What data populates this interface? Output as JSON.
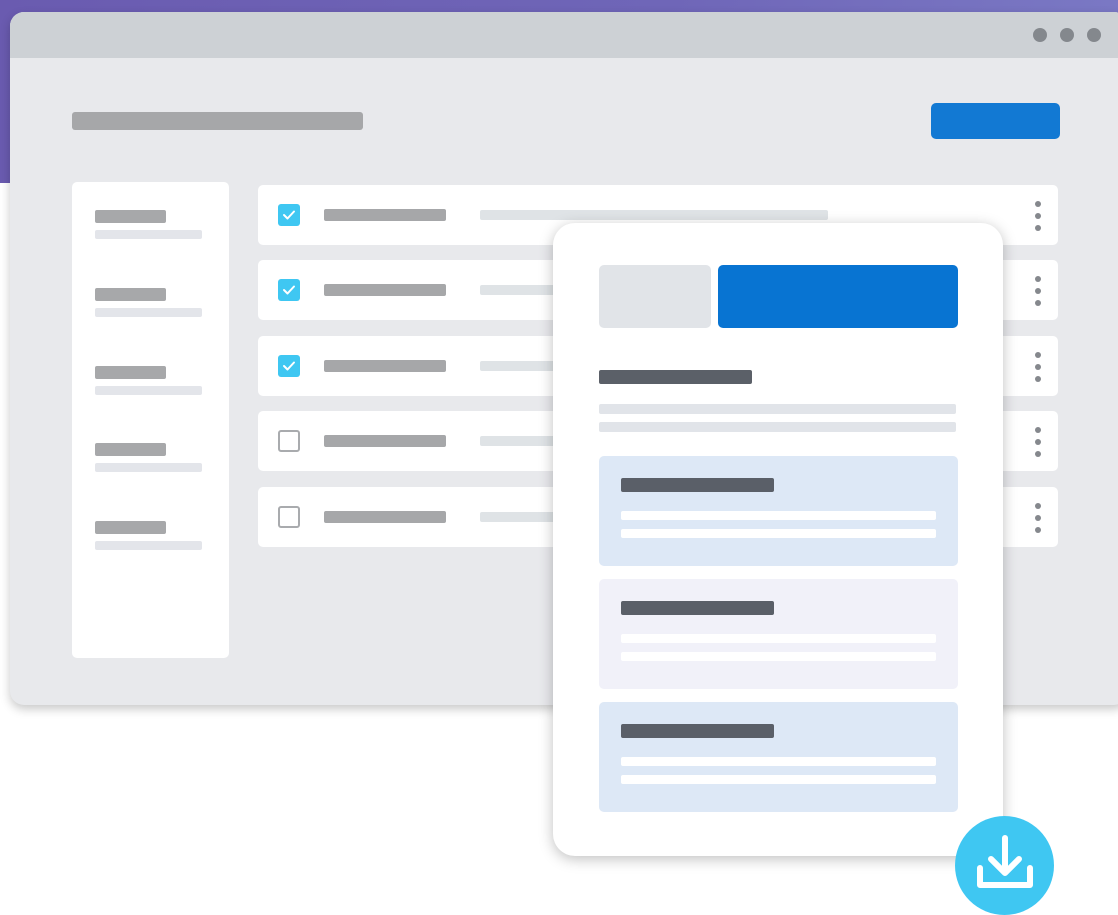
{
  "colors": {
    "background_purple": "#6a5bb0",
    "window_bg": "#e8e9ec",
    "titlebar": "#cdd1d5",
    "accent_blue": "#1279d3",
    "checkbox_checked": "#3fc7f2",
    "panel_blue": "#dde8f6",
    "panel_lavender": "#f1f1f9",
    "download_button": "#3fc7f2"
  },
  "window": {
    "controls": [
      "dot",
      "dot",
      "dot"
    ]
  },
  "list": {
    "rows": [
      {
        "checked": true
      },
      {
        "checked": true
      },
      {
        "checked": true
      },
      {
        "checked": false
      },
      {
        "checked": false
      }
    ]
  },
  "sidebar": {
    "item_count": 5
  },
  "card": {
    "panels": [
      {
        "tone": "blue"
      },
      {
        "tone": "lavender"
      },
      {
        "tone": "blue"
      }
    ]
  },
  "icons": {
    "window_dots": "dots-icon",
    "row_menu": "kebab-icon",
    "checkbox": "check-icon",
    "download": "download-icon"
  }
}
